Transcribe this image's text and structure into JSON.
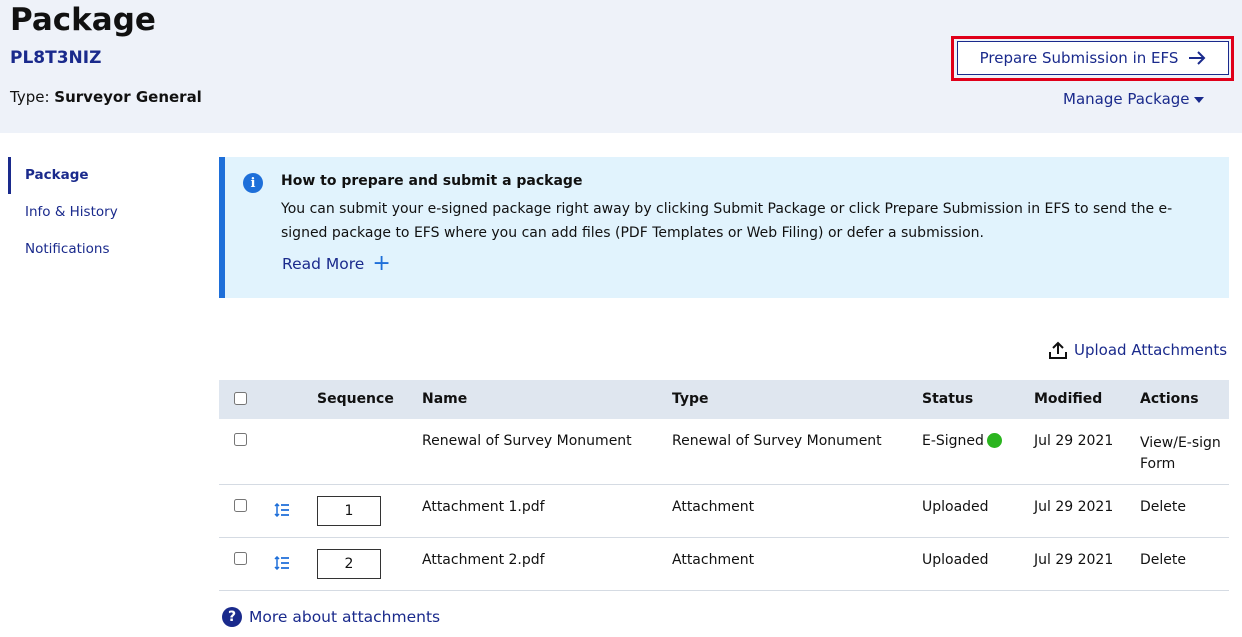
{
  "header": {
    "title": "Package",
    "package_id": "PL8T3NIZ",
    "type_label": "Type:",
    "type_value": "Surveyor General",
    "efs_button_label": "Prepare Submission in EFS",
    "manage_label": "Manage Package"
  },
  "sidenav": {
    "items": [
      {
        "label": "Package"
      },
      {
        "label": "Info & History"
      },
      {
        "label": "Notifications"
      }
    ]
  },
  "info": {
    "title": "How to prepare and submit a package",
    "text": "You can submit your e-signed package right away by clicking Submit Package or click Prepare Submission in EFS to send the e-signed package to EFS where you can add files (PDF Templates or Web Filing) or defer a submission.",
    "read_more": "Read More"
  },
  "upload_label": "Upload Attachments",
  "table": {
    "headers": {
      "sequence": "Sequence",
      "name": "Name",
      "type": "Type",
      "status": "Status",
      "modified": "Modified",
      "actions": "Actions"
    },
    "rows": [
      {
        "name": "Renewal of Survey Monument",
        "type": "Renewal of Survey Monument",
        "status": "E-Signed",
        "modified": "Jul 29 2021",
        "action": "View/E-sign Form"
      },
      {
        "sequence": "1",
        "name": "Attachment 1.pdf",
        "type": "Attachment",
        "status": "Uploaded",
        "modified": "Jul 29 2021",
        "action": "Delete"
      },
      {
        "sequence": "2",
        "name": "Attachment 2.pdf",
        "type": "Attachment",
        "status": "Uploaded",
        "modified": "Jul 29 2021",
        "action": "Delete"
      }
    ]
  },
  "more_about_label": "More about attachments",
  "colors": {
    "link": "#1a2a8c",
    "accent": "#1e6fd9",
    "highlight": "#e0001a",
    "esigned": "#2bb51f"
  }
}
